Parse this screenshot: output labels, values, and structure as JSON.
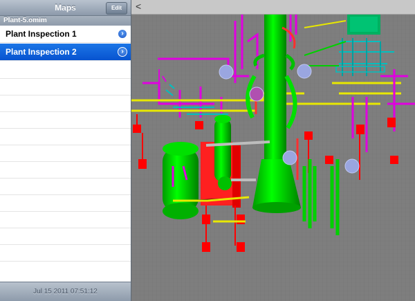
{
  "sidebar": {
    "title": "Maps",
    "edit_label": "Edit",
    "section": "Plant-5.omim",
    "items": [
      {
        "label": "Plant Inspection 1",
        "selected": false
      },
      {
        "label": "Plant Inspection 2",
        "selected": true
      }
    ],
    "footer_date": "Jul 15 2011 07:51:12"
  },
  "viewer": {
    "back_label": "<"
  },
  "colors": {
    "selection": "#1c76e6",
    "vessel_green": "#00e000",
    "pipe_magenta": "#e000e0",
    "pipe_yellow": "#e8e800",
    "support_red": "#ff0000",
    "pipe_cyan": "#00c0c0",
    "marker_blue": "#9aa6e0",
    "background": "#808080"
  },
  "icons": {
    "disclosure": "chevron-right-icon"
  }
}
